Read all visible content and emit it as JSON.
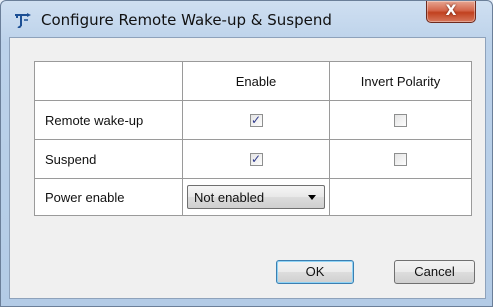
{
  "window": {
    "title": "Configure Remote Wake-up & Suspend",
    "close_label": "X",
    "app_icon": "wireless-plug-icon"
  },
  "table": {
    "headers": [
      "",
      "Enable",
      "Invert Polarity"
    ],
    "rows": [
      {
        "label": "Remote wake-up",
        "enable": true,
        "invert": false
      },
      {
        "label": "Suspend",
        "enable": true,
        "invert": false
      }
    ],
    "power": {
      "label": "Power enable",
      "selected": "Not enabled"
    }
  },
  "buttons": {
    "ok": "OK",
    "cancel": "Cancel"
  },
  "colors": {
    "checkmark": "#2f3a8c",
    "default_button_border": "#3c7fb1"
  }
}
